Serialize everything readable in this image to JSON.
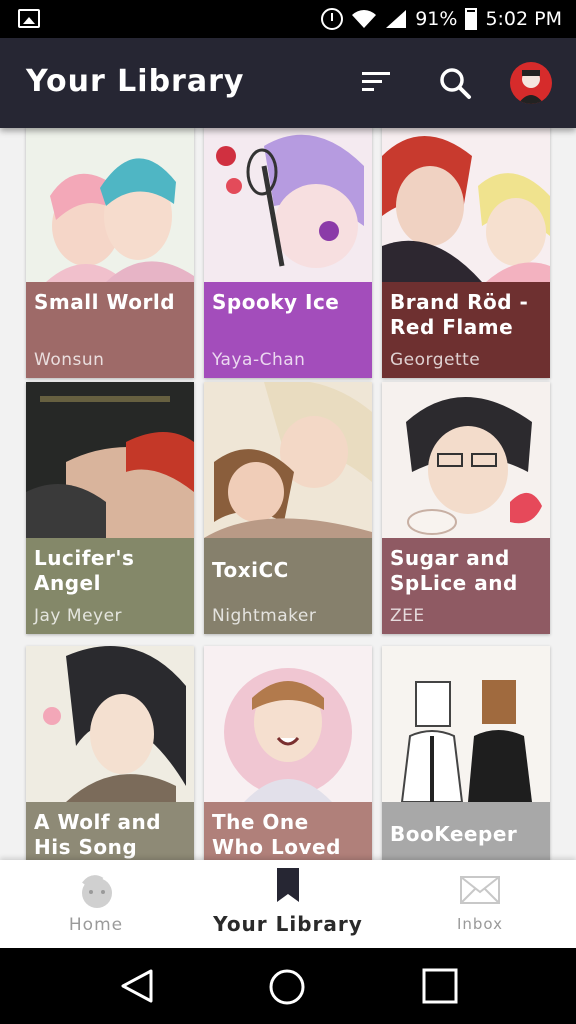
{
  "status_bar": {
    "battery": "91%",
    "time": "5:02 PM"
  },
  "header": {
    "title": "Your Library"
  },
  "library": {
    "items": [
      {
        "title": "Small World",
        "author": "Wonsun",
        "color": "#9e6a68"
      },
      {
        "title": "Spooky Ice",
        "author": "Yaya-Chan",
        "color": "#a34dbb"
      },
      {
        "title": "Brand Röd - Red Flame",
        "author": "Georgette",
        "color": "#6e3030"
      },
      {
        "title": "Lucifer's Angel",
        "author": "Jay Meyer",
        "color": "#848869"
      },
      {
        "title": "ToxiCC",
        "author": "Nightmaker",
        "color": "#86806c"
      },
      {
        "title": "Sugar and SpLice and",
        "author": "ZEE",
        "color": "#8f5a63"
      },
      {
        "title": "A Wolf and His Song",
        "author": "",
        "color": "#8e8a76"
      },
      {
        "title": "The One Who Loved You",
        "author": "",
        "color": "#b0807a"
      },
      {
        "title": "BooKeeper",
        "author": "",
        "color": "#a8a8a8"
      }
    ]
  },
  "bottom_nav": {
    "home": "Home",
    "library": "Your Library",
    "inbox": "Inbox"
  },
  "icons": {
    "filter": "sort-lines-icon",
    "search": "search-icon",
    "home": "home-face-icon",
    "library": "bookmark-icon",
    "inbox": "envelope-icon"
  }
}
